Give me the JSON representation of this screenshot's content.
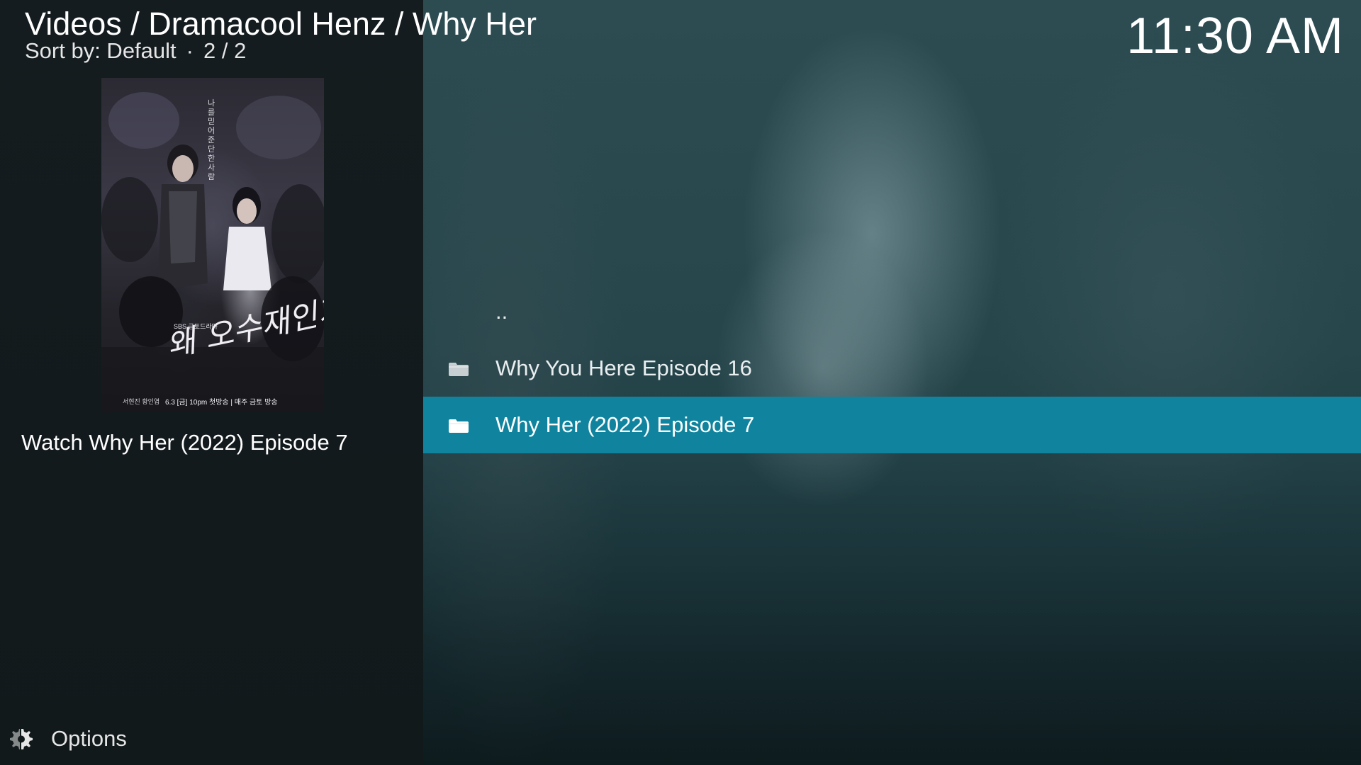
{
  "header": {
    "breadcrumb": "Videos / Dramacool Henz / Why Her",
    "sort_label": "Sort by: Default",
    "separator": "·",
    "position": "2 / 2",
    "clock": "11:30 AM"
  },
  "info_panel": {
    "poster": {
      "title_text": "왜 오수재인가",
      "tagline": "나를 믿어준단 한 사람",
      "network": "SBS 금토드라마",
      "airing": "6.3 [금] 10pm 첫방송 | 매주 금토 방송",
      "cast": "서현진  황인엽"
    },
    "plot": "Watch Why Her (2022) Episode 7"
  },
  "list": {
    "items": [
      {
        "label": "..",
        "icon": "none",
        "selected": false
      },
      {
        "label": "Why You Here Episode 16",
        "icon": "folder-icon",
        "selected": false
      },
      {
        "label": "Why Her (2022) Episode 7",
        "icon": "folder-icon",
        "selected": true
      }
    ]
  },
  "footer": {
    "options_label": "Options",
    "options_icon": "gear-icon"
  },
  "colors": {
    "selection": "#10849f",
    "left_panel": "#141c1f"
  }
}
